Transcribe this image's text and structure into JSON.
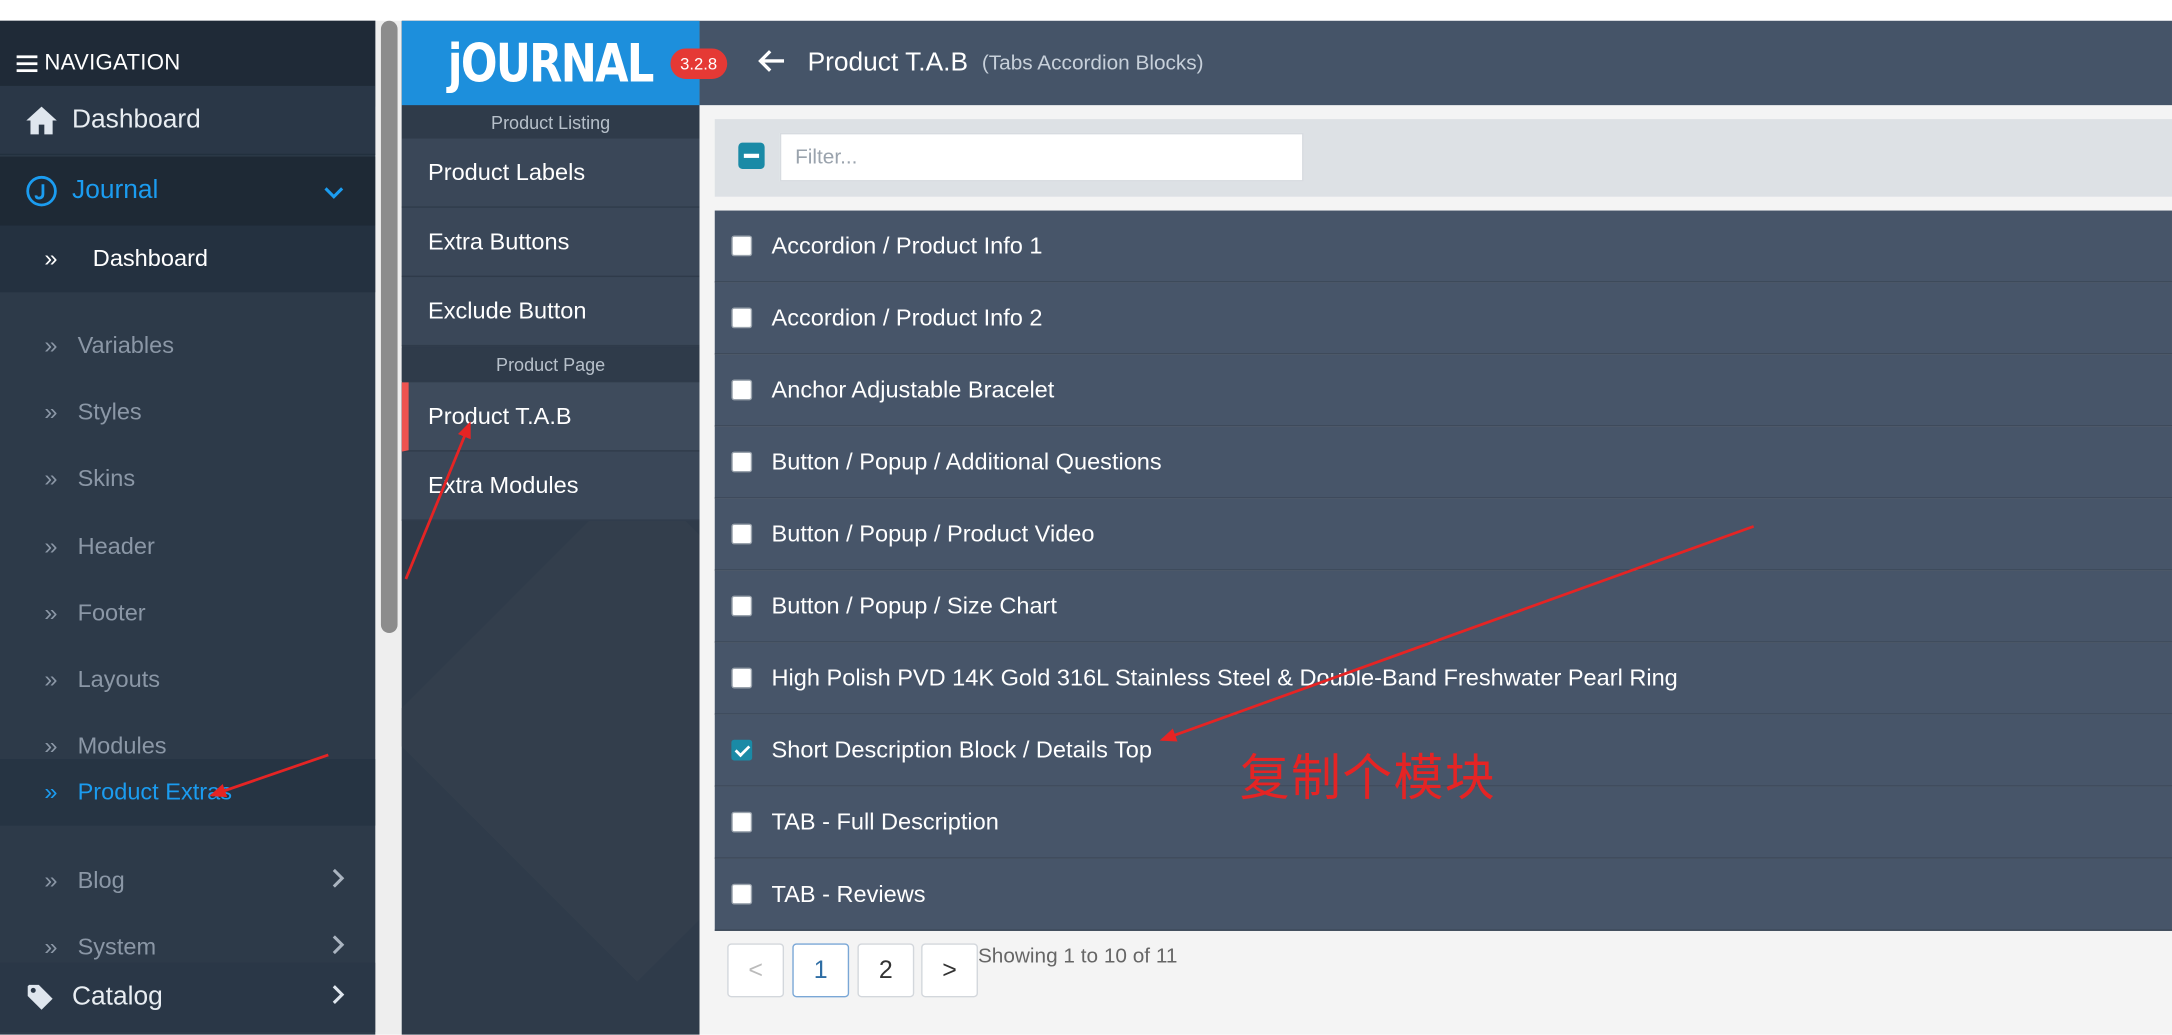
{
  "nav": {
    "header": "NAVIGATION",
    "dashboard": "Dashboard",
    "journal": "Journal",
    "sub_items": [
      "Dashboard",
      "Variables",
      "Styles",
      "Skins",
      "Header",
      "Footer",
      "Layouts",
      "Modules",
      "Product Extras",
      "Blog",
      "System"
    ],
    "catalog": "Catalog"
  },
  "journal_panel": {
    "logo": "jOURNAL",
    "version": "3.2.8",
    "section_listing": "Product Listing",
    "listing_items": [
      "Product Labels",
      "Extra Buttons",
      "Exclude Button"
    ],
    "section_page": "Product Page",
    "page_items": [
      "Product T.A.B",
      "Extra Modules"
    ]
  },
  "header": {
    "title": "Product T.A.B",
    "subtitle": "(Tabs Accordion Blocks)"
  },
  "filter": {
    "placeholder": "Filter..."
  },
  "rows": [
    {
      "label": "Accordion / Product Info 1",
      "checked": false
    },
    {
      "label": "Accordion / Product Info 2",
      "checked": false
    },
    {
      "label": "Anchor Adjustable Bracelet",
      "checked": false
    },
    {
      "label": "Button / Popup / Additional Questions",
      "checked": false
    },
    {
      "label": "Button / Popup / Product Video",
      "checked": false
    },
    {
      "label": "Button / Popup / Size Chart",
      "checked": false
    },
    {
      "label": "High Polish PVD 14K Gold 316L Stainless Steel & Double-Band Freshwater Pearl Ring",
      "checked": false
    },
    {
      "label": "Short Description Block / Details Top",
      "checked": true
    },
    {
      "label": "TAB - Full Description",
      "checked": false
    },
    {
      "label": "TAB - Reviews",
      "checked": false
    }
  ],
  "pagination": {
    "prev": "<",
    "pages": [
      "1",
      "2"
    ],
    "next": ">",
    "showing": "Showing 1 to 10 of 11"
  },
  "annotation": {
    "text": "复制个模块",
    "color": "#e52424"
  },
  "colors": {
    "accent": "#1b9cf0",
    "active_marker": "#ef5350",
    "badge": "#e53935",
    "logo_bg": "#1d8fdc"
  }
}
